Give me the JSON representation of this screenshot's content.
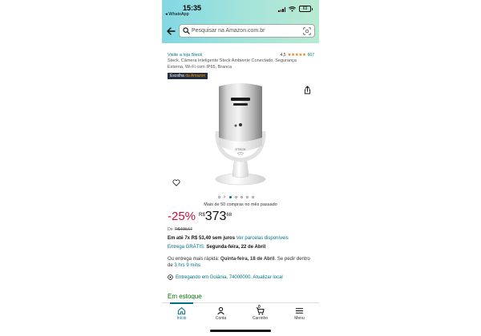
{
  "status_bar": {
    "time": "15:35",
    "back_app": "◂ WhatsApp",
    "battery": "63"
  },
  "search": {
    "placeholder": "Pesquisar na Amazon.com.br"
  },
  "store": {
    "link": "Visite a loja Steck"
  },
  "rating": {
    "value": "4,5",
    "stars": "★★★★★",
    "count": "607"
  },
  "product": {
    "title": "Steck, Câmera Inteligente Steck Ambiente Conectado, Segurança Externa, Wi-Fi com IP65, Branca",
    "badge_a": "Escolha ",
    "badge_b": "da Amazon",
    "device_brand": "STECK"
  },
  "bought": "Mais de 50 compras no mês passado",
  "price": {
    "discount": "-25%",
    "currency": "R$",
    "whole": "373",
    "cents": "68",
    "list_label": "De: ",
    "list_price": "R$498,67"
  },
  "installments": {
    "text": "Em até 7x R$ 53,40 sem juros",
    "link": "Ver parcelas disponíveis"
  },
  "delivery": {
    "free_label": "Entrega GRÁTIS:",
    "free_date": "Segunda-feira, 22 de Abril"
  },
  "fast": {
    "part1": "Ou entrega mais rápida: ",
    "date": "Quinta-feira, 18 de Abril",
    "part2": ". Se pedir dentro de ",
    "time": "3 hrs 9 mins"
  },
  "location": "Entregando em Goiânia, 74000000. Atualizar local",
  "stock": "Em estoque",
  "tabs": [
    {
      "label": "Início"
    },
    {
      "label": "Conta"
    },
    {
      "label": "Carrinho",
      "badge": "0"
    },
    {
      "label": "Menu"
    }
  ],
  "colors": {
    "accent": "#007185",
    "deal_red": "#cc0c39",
    "stock_green": "#007600",
    "star_orange": "#de7921"
  }
}
